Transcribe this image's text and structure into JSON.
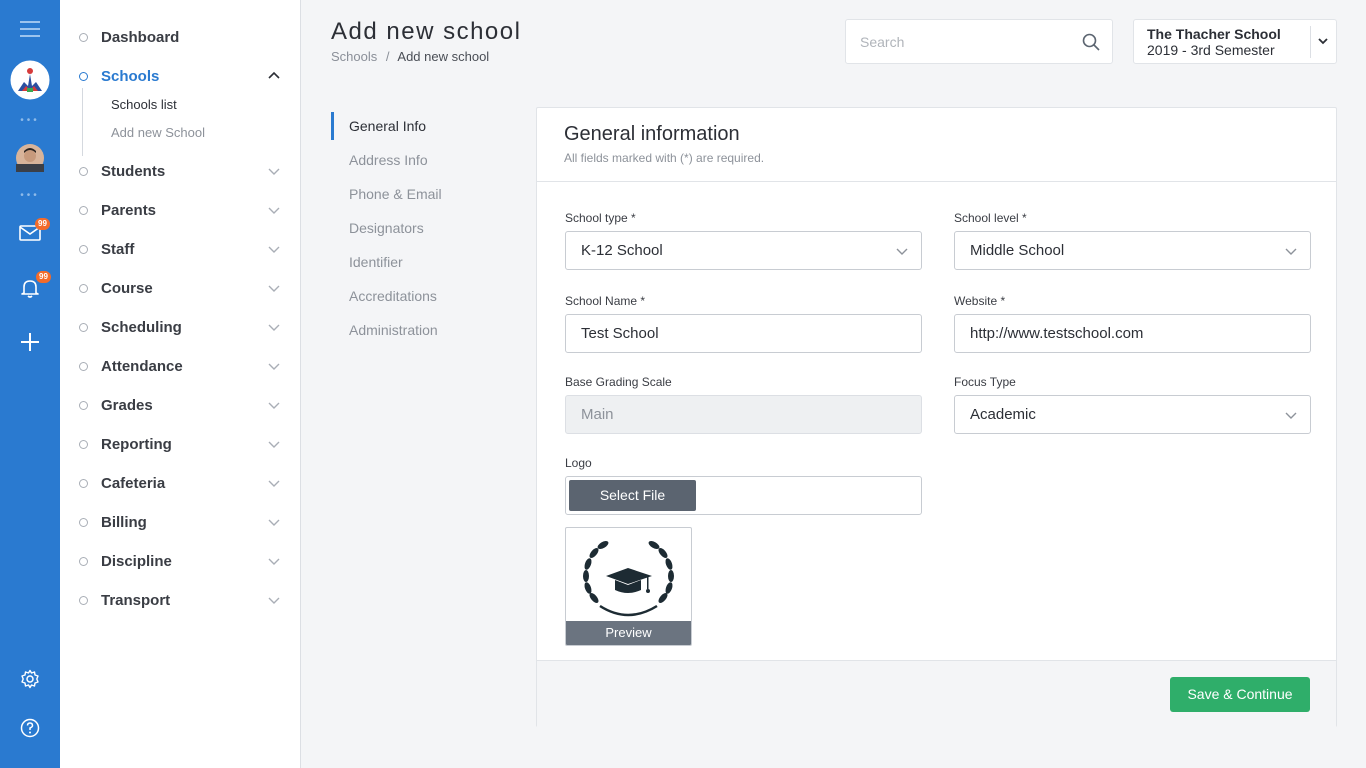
{
  "rail": {
    "mail_badge": "99",
    "notification_badge": "99"
  },
  "sidebar": {
    "items": [
      {
        "label": "Dashboard"
      },
      {
        "label": "Schools"
      },
      {
        "label": "Students"
      },
      {
        "label": "Parents"
      },
      {
        "label": "Staff"
      },
      {
        "label": "Course"
      },
      {
        "label": "Scheduling"
      },
      {
        "label": "Attendance"
      },
      {
        "label": "Grades"
      },
      {
        "label": "Reporting"
      },
      {
        "label": "Cafeteria"
      },
      {
        "label": "Billing"
      },
      {
        "label": "Discipline"
      },
      {
        "label": "Transport"
      }
    ],
    "schools_sub": [
      "Schools list",
      "Add new School"
    ]
  },
  "header": {
    "title": "Add new school",
    "breadcrumb": [
      "Schools",
      "/",
      "Add new school"
    ],
    "search_placeholder": "Search",
    "school_name": "The Thacher School",
    "term": "2019 - 3rd Semester"
  },
  "tabs": [
    "General Info",
    "Address Info",
    "Phone & Email",
    "Designators",
    "Identifier",
    "Accreditations",
    "Administration"
  ],
  "form": {
    "title": "General information",
    "subtitle": "All fields marked with (*) are required.",
    "school_type_label": "School type *",
    "school_type_value": "K-12 School",
    "school_level_label": "School level *",
    "school_level_value": "Middle School",
    "school_name_label": "School Name *",
    "school_name_value": "Test School",
    "website_label": "Website *",
    "website_value": "http://www.testschool.com",
    "grading_label": "Base Grading Scale",
    "grading_value": "Main",
    "focus_label": "Focus Type",
    "focus_value": "Academic",
    "logo_label": "Logo",
    "select_file": "Select File",
    "preview": "Preview",
    "save": "Save & Continue"
  },
  "colors": {
    "accent": "#2a7ad0",
    "save": "#2fae6a",
    "badge": "#f36b2a"
  }
}
